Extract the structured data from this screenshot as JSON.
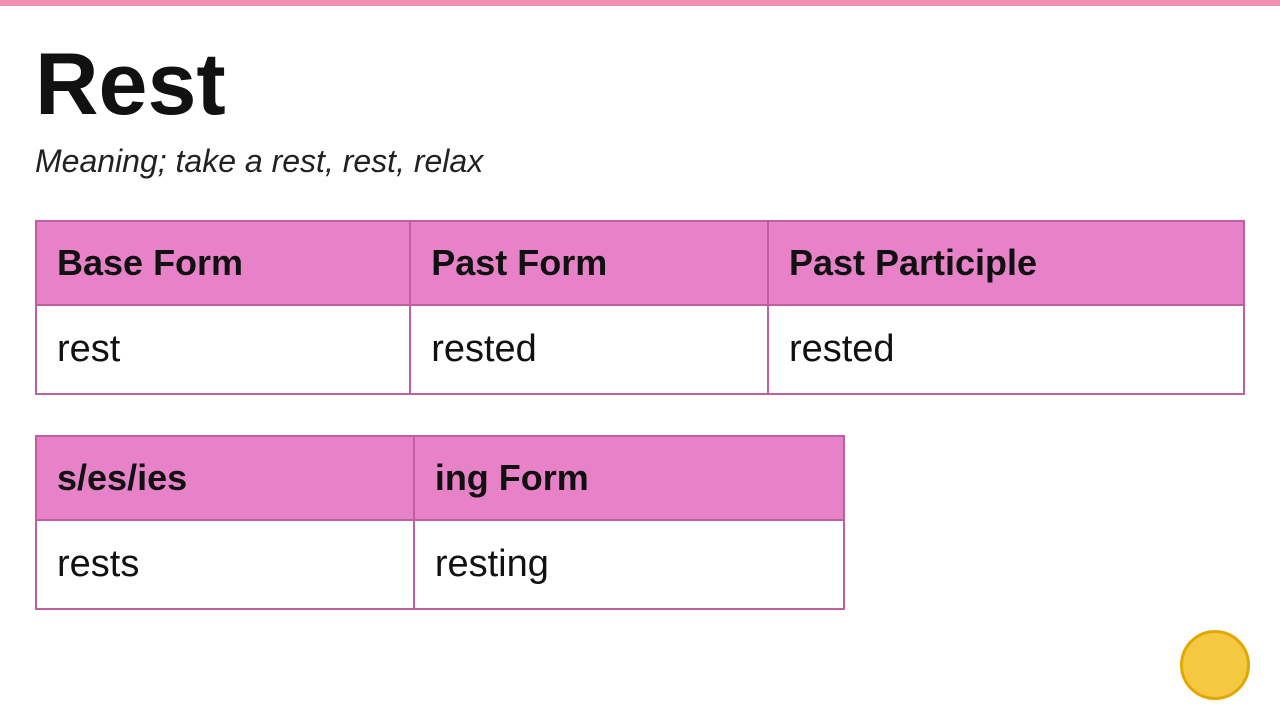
{
  "topBar": {
    "color": "#f48fb1"
  },
  "word": {
    "title": "Rest",
    "meaning": "Meaning; take a rest, rest, relax"
  },
  "table1": {
    "headers": [
      "Base Form",
      "Past Form",
      "Past Participle"
    ],
    "rows": [
      [
        "rest",
        "rested",
        "rested"
      ]
    ]
  },
  "table2": {
    "headers": [
      "s/es/ies",
      "ing Form"
    ],
    "rows": [
      [
        "rests",
        "resting"
      ]
    ]
  }
}
